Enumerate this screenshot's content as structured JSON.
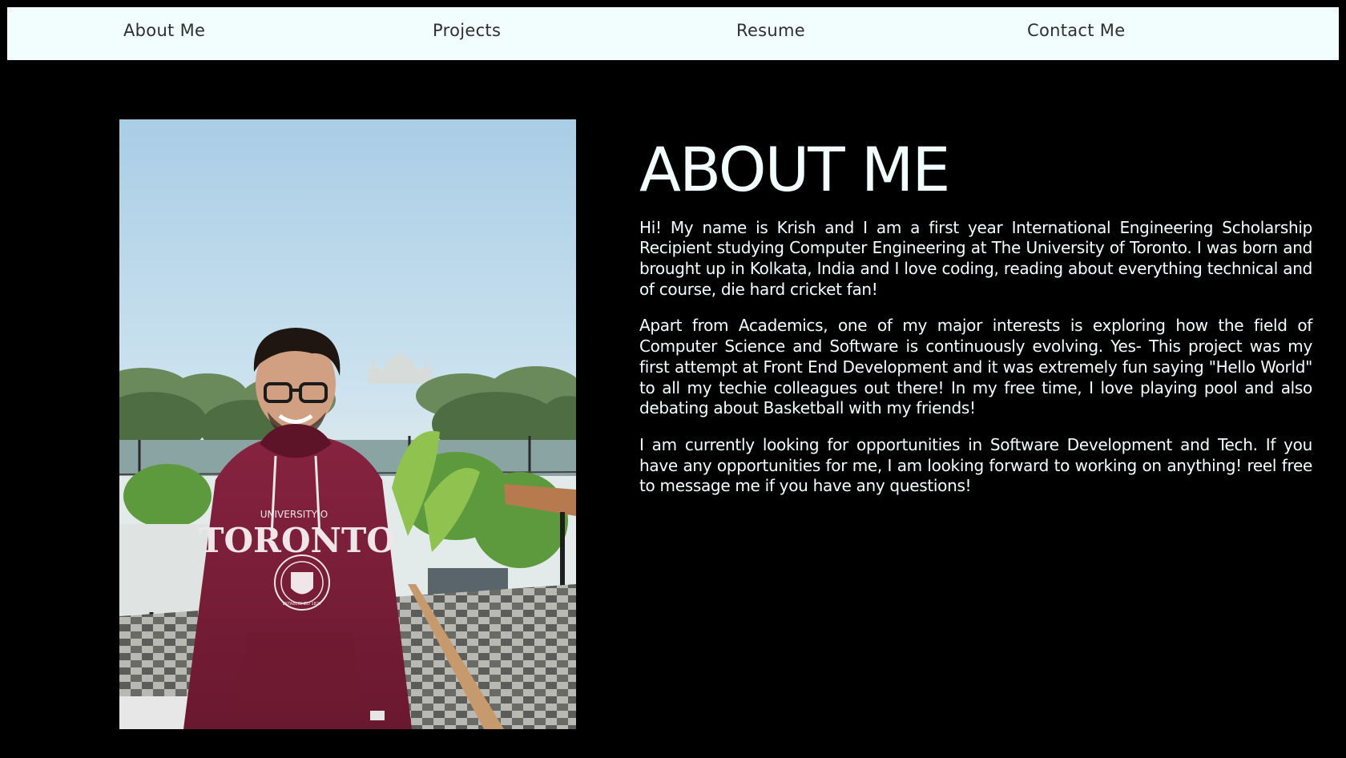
{
  "nav": {
    "items": [
      {
        "label": "About Me"
      },
      {
        "label": "Projects"
      },
      {
        "label": "Resume"
      },
      {
        "label": "Contact Me"
      }
    ]
  },
  "about": {
    "title": "ABOUT ME",
    "paragraphs": [
      "Hi! My name is Krish and I am a first year International Engineering Scholarship Recipient studying Computer Engineering at The University of Toronto. I was born and brought up in Kolkata, India and I love coding, reading about everything technical and of course, die hard cricket fan!",
      "Apart from Academics, one of my major interests is exploring how the field of Computer Science and Software is continuously evolving. Yes- This project was my first attempt at Front End Development and it was extremely fun saying \"Hello World\" to all my techie colleagues out there! In my free time, I love playing pool and also debating about Basketball with my friends!",
      "I am currently looking for opportunities in Software Development and Tech. If you have any opportunities for me, I am looking forward to working on anything! reel free to message me if you have any questions!"
    ]
  },
  "photo": {
    "hoodie_text_top": "UNIVERSITY O",
    "hoodie_text_main": "TORONTO",
    "hoodie_crest_text": "ESTABLISHED 1827"
  },
  "colors": {
    "background": "#000000",
    "navbar": "#f2fefe",
    "nav_text": "#2f2f2f",
    "text": "#f2fefe",
    "hoodie": "#7a1d35"
  }
}
